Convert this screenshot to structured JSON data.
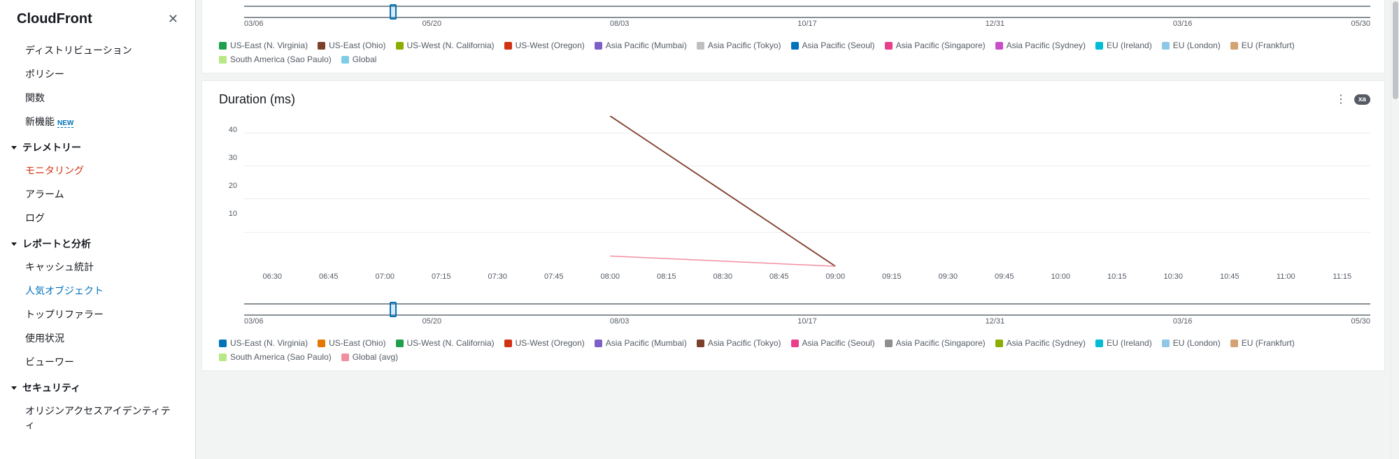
{
  "sidebar": {
    "title": "CloudFront",
    "top_links": [
      {
        "label": "ディストリビューション"
      },
      {
        "label": "ポリシー"
      },
      {
        "label": "関数"
      },
      {
        "label": "新機能",
        "new": true
      }
    ],
    "sections": [
      {
        "title": "テレメトリー",
        "items": [
          {
            "label": "モニタリング",
            "active": true
          },
          {
            "label": "アラーム"
          },
          {
            "label": "ログ"
          }
        ]
      },
      {
        "title": "レポートと分析",
        "items": [
          {
            "label": "キャッシュ統計"
          },
          {
            "label": "人気オブジェクト",
            "secondary": true
          },
          {
            "label": "トップリファラー"
          },
          {
            "label": "使用状況"
          },
          {
            "label": "ビューワー"
          }
        ]
      },
      {
        "title": "セキュリティ",
        "items": [
          {
            "label": "オリジンアクセスアイデンティティ"
          }
        ]
      }
    ],
    "new_badge": "NEW"
  },
  "chart_data": [
    {
      "type": "line",
      "title": "",
      "brush_ticks": [
        "03/06",
        "05/20",
        "08/03",
        "10/17",
        "12/31",
        "03/16",
        "05/30"
      ],
      "brush_handle_pct": 15,
      "series_legend": [
        {
          "name": "US-East (N. Virginia)",
          "color": "#1f9e4b"
        },
        {
          "name": "US-East (Ohio)",
          "color": "#7b3f2a"
        },
        {
          "name": "US-West (N. California)",
          "color": "#8aad00"
        },
        {
          "name": "US-West (Oregon)",
          "color": "#d13212"
        },
        {
          "name": "Asia Pacific (Mumbai)",
          "color": "#7d5fc7"
        },
        {
          "name": "Asia Pacific (Tokyo)",
          "color": "#bfbfbf"
        },
        {
          "name": "Asia Pacific (Seoul)",
          "color": "#0073bb"
        },
        {
          "name": "Asia Pacific (Singapore)",
          "color": "#e83e8c"
        },
        {
          "name": "Asia Pacific (Sydney)",
          "color": "#c94fc9"
        },
        {
          "name": "EU (Ireland)",
          "color": "#00bcd4"
        },
        {
          "name": "EU (London)",
          "color": "#8ec7e8"
        },
        {
          "name": "EU (Frankfurt)",
          "color": "#d4a373"
        },
        {
          "name": "South America (Sao Paulo)",
          "color": "#b8e986"
        },
        {
          "name": "Global",
          "color": "#7fcde4"
        }
      ]
    },
    {
      "type": "line",
      "title": "Duration (ms)",
      "ylim": [
        0,
        45
      ],
      "y_ticks": [
        10,
        20,
        30,
        40
      ],
      "x_ticks": [
        "06:30",
        "06:45",
        "07:00",
        "07:15",
        "07:30",
        "07:45",
        "08:00",
        "08:15",
        "08:30",
        "08:45",
        "09:00",
        "09:15",
        "09:30",
        "09:45",
        "10:00",
        "10:15",
        "10:30",
        "10:45",
        "11:00",
        "11:15"
      ],
      "series": [
        {
          "name": "Asia Pacific (Tokyo)",
          "color": "#7b3f2a",
          "x": [
            "08:00",
            "09:00"
          ],
          "y": [
            45,
            1
          ]
        },
        {
          "name": "Global (avg)",
          "color": "#f28ea0",
          "x": [
            "08:00",
            "09:00"
          ],
          "y": [
            4,
            1
          ]
        }
      ],
      "brush_ticks": [
        "03/06",
        "05/20",
        "08/03",
        "10/17",
        "12/31",
        "03/16",
        "05/30"
      ],
      "brush_handle_pct": 15,
      "series_legend": [
        {
          "name": "US-East (N. Virginia)",
          "color": "#0073bb"
        },
        {
          "name": "US-East (Ohio)",
          "color": "#e57700"
        },
        {
          "name": "US-West (N. California)",
          "color": "#1f9e4b"
        },
        {
          "name": "US-West (Oregon)",
          "color": "#d13212"
        },
        {
          "name": "Asia Pacific (Mumbai)",
          "color": "#7d5fc7"
        },
        {
          "name": "Asia Pacific (Tokyo)",
          "color": "#7b3f2a"
        },
        {
          "name": "Asia Pacific (Seoul)",
          "color": "#e83e8c"
        },
        {
          "name": "Asia Pacific (Singapore)",
          "color": "#8e8e8e"
        },
        {
          "name": "Asia Pacific (Sydney)",
          "color": "#8aad00"
        },
        {
          "name": "EU (Ireland)",
          "color": "#00bcd4"
        },
        {
          "name": "EU (London)",
          "color": "#8ec7e8"
        },
        {
          "name": "EU (Frankfurt)",
          "color": "#d4a373"
        },
        {
          "name": "South America (Sao Paulo)",
          "color": "#b8e986"
        },
        {
          "name": "Global (avg)",
          "color": "#f28ea0"
        }
      ]
    }
  ],
  "xa_pill": "xa"
}
